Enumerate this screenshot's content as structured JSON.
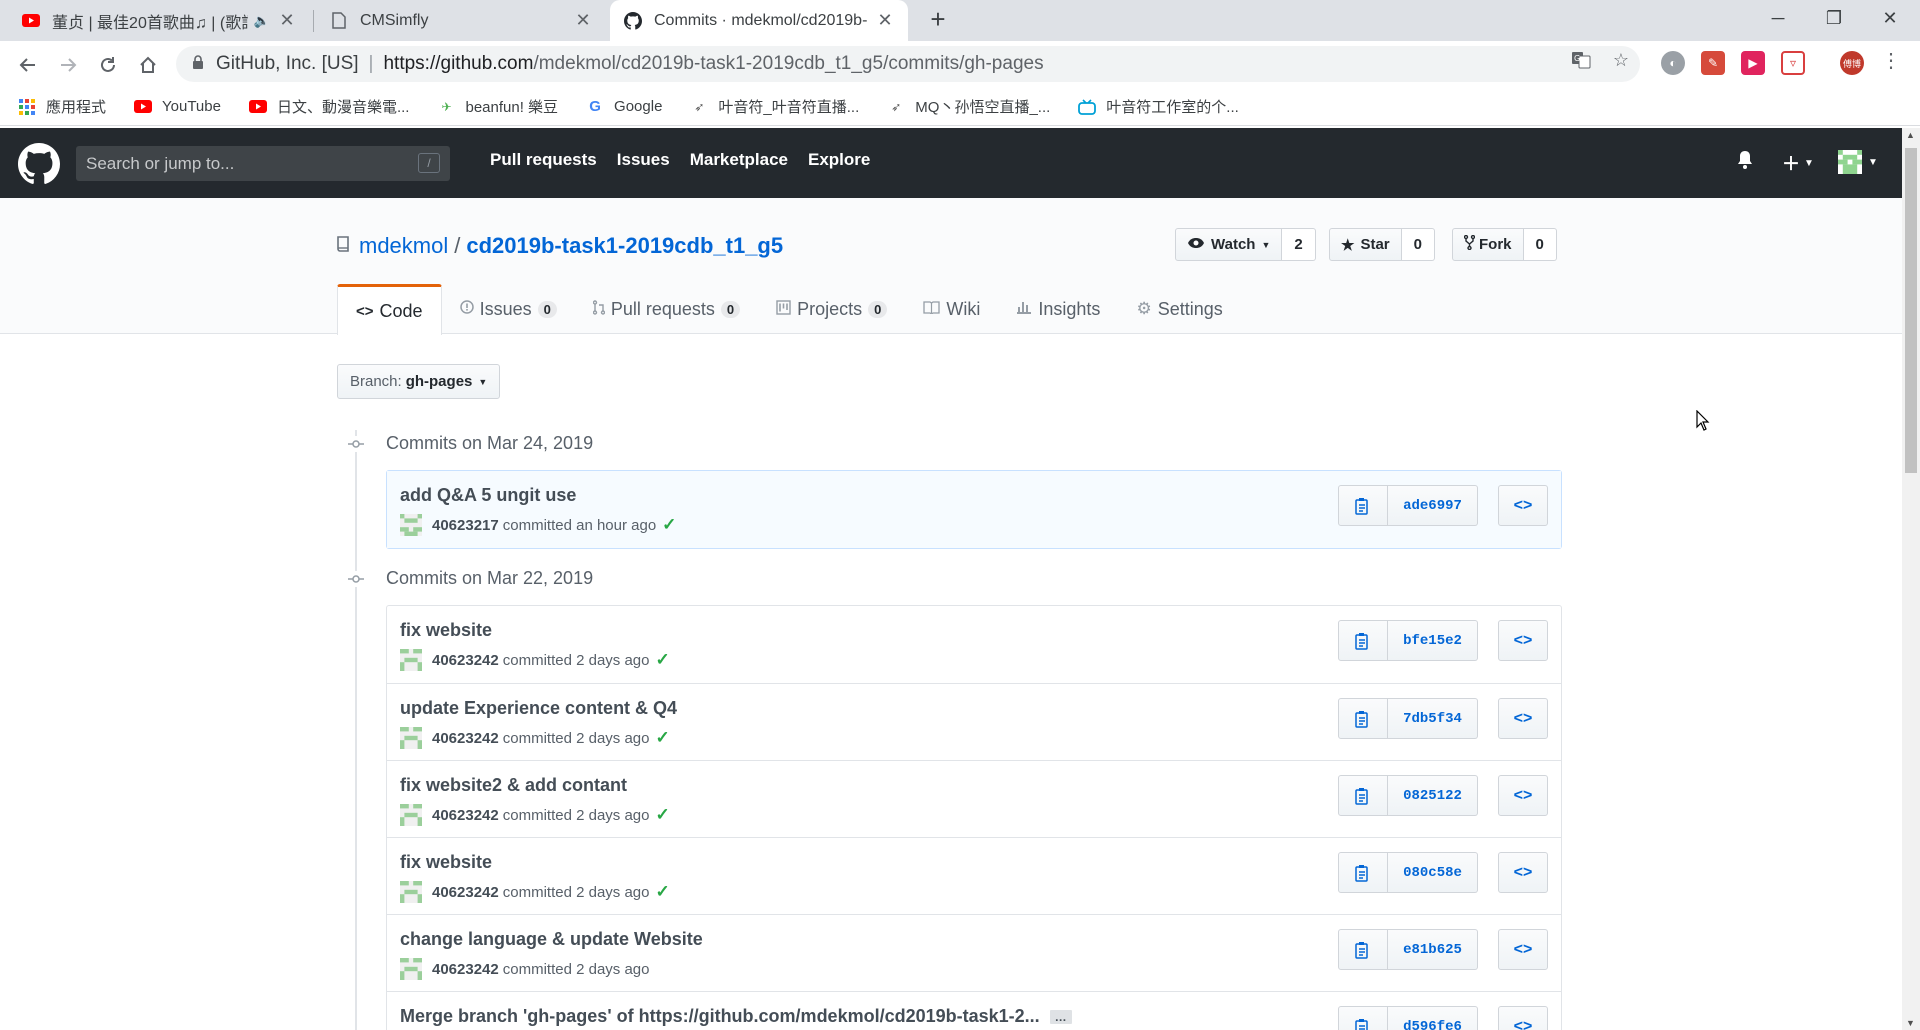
{
  "browser": {
    "tabs": [
      {
        "title": "董贞 | 最佳20首歌曲♫ | (歌詞",
        "audio": "🔈",
        "close": "✕"
      },
      {
        "title": "CMSimfly",
        "close": "✕"
      },
      {
        "title": "Commits · mdekmol/cd2019b-",
        "close": "✕"
      }
    ],
    "new_tab": "+",
    "window": {
      "minimize": "─",
      "restore": "❐",
      "close": "✕"
    },
    "address": {
      "org": "GitHub, Inc. [US]",
      "url_host": "https://github.com",
      "url_path": "/mdekmol/cd2019b-task1-2019cdb_t1_g5/commits/gh-pages"
    },
    "bookmarks": [
      {
        "label": "應用程式",
        "icon": "apps-icon"
      },
      {
        "label": "YouTube",
        "icon": "youtube-icon"
      },
      {
        "label": "日文、動漫音樂電...",
        "icon": "youtube-icon"
      },
      {
        "label": "beanfun! 樂豆",
        "icon": "beanfun-icon"
      },
      {
        "label": "Google",
        "icon": "google-icon"
      },
      {
        "label": "叶音符_叶音符直播...",
        "icon": "rocket-icon"
      },
      {
        "label": "MQ丶孙悟空直播_...",
        "icon": "rocket-icon"
      },
      {
        "label": "叶音符工作室的个...",
        "icon": "bilibili-icon"
      }
    ],
    "profile_initials": "傅博"
  },
  "github": {
    "search_placeholder": "Search or jump to...",
    "search_key": "/",
    "nav": [
      "Pull requests",
      "Issues",
      "Marketplace",
      "Explore"
    ]
  },
  "repo": {
    "owner": "mdekmol",
    "separator": "/",
    "name": "cd2019b-task1-2019cdb_t1_g5",
    "watch_label": "Watch",
    "watch_count": "2",
    "star_label": "Star",
    "star_count": "0",
    "fork_label": "Fork",
    "fork_count": "0",
    "tabs": [
      {
        "label": "Code",
        "icon": "<>"
      },
      {
        "label": "Issues",
        "count": "0"
      },
      {
        "label": "Pull requests",
        "count": "0"
      },
      {
        "label": "Projects",
        "count": "0"
      },
      {
        "label": "Wiki"
      },
      {
        "label": "Insights"
      },
      {
        "label": "Settings"
      }
    ]
  },
  "branch": {
    "label": "Branch:",
    "name": "gh-pages"
  },
  "groups": [
    {
      "title": "Commits on Mar 24, 2019",
      "commits": [
        {
          "message": "add Q&A 5 ungit use",
          "author": "40623217",
          "time": "committed an hour ago",
          "sha": "ade6997",
          "verified": true
        }
      ]
    },
    {
      "title": "Commits on Mar 22, 2019",
      "commits": [
        {
          "message": "fix website",
          "author": "40623242",
          "time": "committed 2 days ago",
          "sha": "bfe15e2",
          "verified": true
        },
        {
          "message": "update Experience content & Q4",
          "author": "40623242",
          "time": "committed 2 days ago",
          "sha": "7db5f34",
          "verified": true
        },
        {
          "message": "fix website2 & add contant",
          "author": "40623242",
          "time": "committed 2 days ago",
          "sha": "0825122",
          "verified": true
        },
        {
          "message": "fix website",
          "author": "40623242",
          "time": "committed 2 days ago",
          "sha": "080c58e",
          "verified": true
        },
        {
          "message": "change language & update Website",
          "author": "40623242",
          "time": "committed 2 days ago",
          "sha": "e81b625",
          "verified": false
        },
        {
          "message": "Merge branch 'gh-pages' of https://github.com/mdekmol/cd2019b-task1-2...",
          "author": "",
          "time": "",
          "sha": "d596fe6",
          "verified": false,
          "truncated": "…"
        }
      ]
    }
  ]
}
